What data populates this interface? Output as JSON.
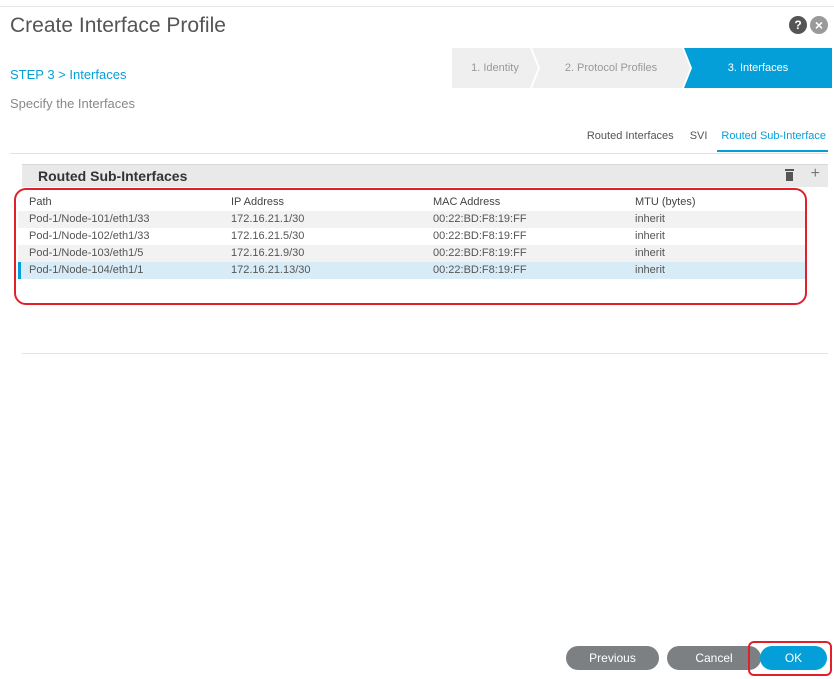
{
  "dialog": {
    "title": "Create Interface Profile",
    "help_icon": "help-icon",
    "close_icon": "close-icon"
  },
  "step": {
    "label": "STEP 3 > Interfaces",
    "subtitle": "Specify the Interfaces"
  },
  "wizard": {
    "steps": [
      {
        "label": "1. Identity",
        "active": false
      },
      {
        "label": "2. Protocol Profiles",
        "active": false
      },
      {
        "label": "3. Interfaces",
        "active": true
      }
    ]
  },
  "subtabs": [
    {
      "label": "Routed Interfaces",
      "active": false
    },
    {
      "label": "SVI",
      "active": false
    },
    {
      "label": "Routed Sub-Interface",
      "active": true
    }
  ],
  "section": {
    "title": "Routed Sub-Interfaces",
    "actions": [
      "trash-icon",
      "plus-icon"
    ]
  },
  "table": {
    "columns": [
      "Path",
      "IP Address",
      "MAC Address",
      "MTU (bytes)"
    ],
    "rows": [
      [
        "Pod-1/Node-101/eth1/33",
        "172.16.21.1/30",
        "00:22:BD:F8:19:FF",
        "inherit"
      ],
      [
        "Pod-1/Node-102/eth1/33",
        "172.16.21.5/30",
        "00:22:BD:F8:19:FF",
        "inherit"
      ],
      [
        "Pod-1/Node-103/eth1/5",
        "172.16.21.9/30",
        "00:22:BD:F8:19:FF",
        "inherit"
      ],
      [
        "Pod-1/Node-104/eth1/1",
        "172.16.21.13/30",
        "00:22:BD:F8:19:FF",
        "inherit"
      ]
    ],
    "selected_row": 3
  },
  "footer": {
    "previous": "Previous",
    "cancel": "Cancel",
    "ok": "OK"
  },
  "colors": {
    "accent": "#049fd9",
    "highlight": "#e0202a",
    "button_gray": "#7d8083"
  }
}
